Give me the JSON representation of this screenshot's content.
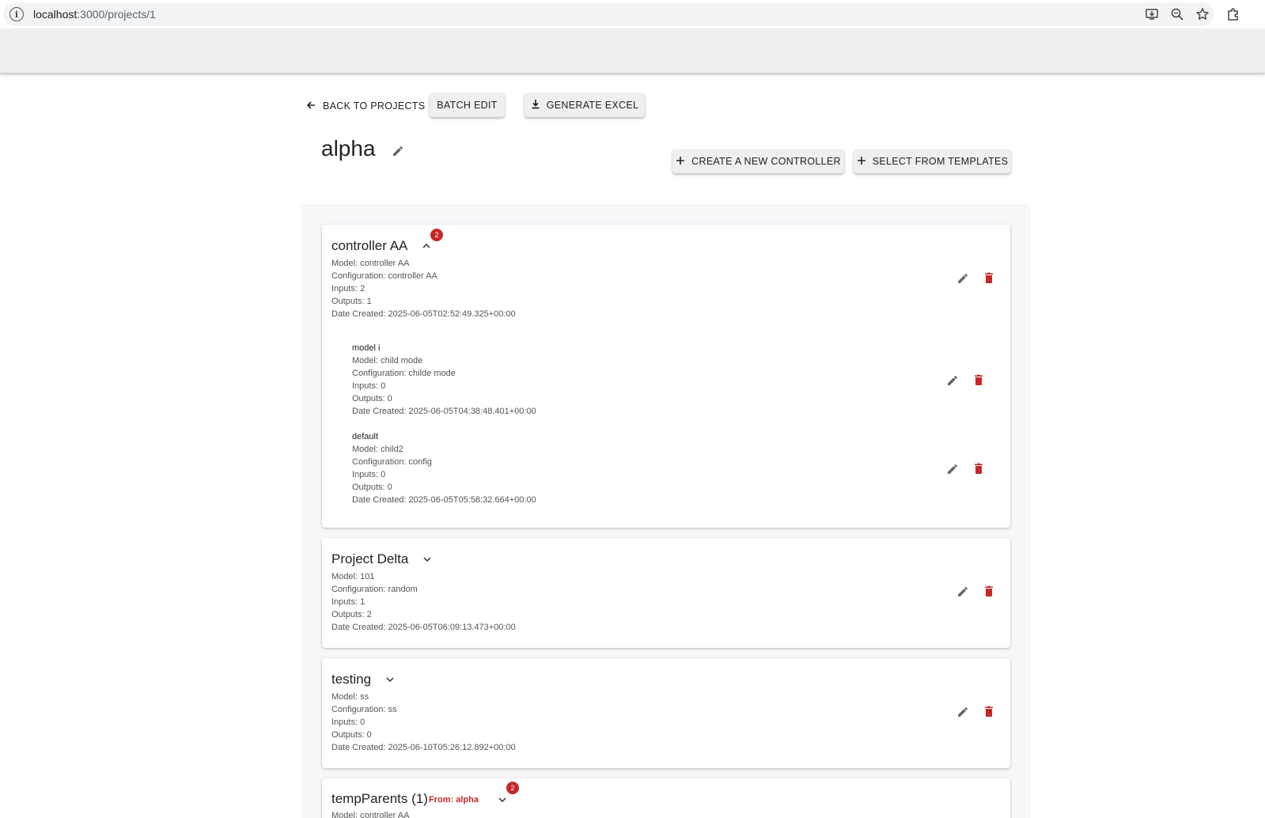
{
  "browser": {
    "url_host": "localhost",
    "url_path": ":3000/projects/1"
  },
  "actions": {
    "back_label": "BACK TO PROJECTS",
    "batch_edit_label": "BATCH EDIT",
    "generate_excel_label": "GENERATE EXCEL",
    "create_controller_label": "CREATE A NEW CONTROLLER",
    "select_templates_label": "SELECT FROM TEMPLATES"
  },
  "project": {
    "title": "alpha"
  },
  "controllers": [
    {
      "name": "controller AA",
      "badge": "2",
      "expanded": true,
      "model": "Model: controller AA",
      "configuration": "Configuration: controller AA",
      "inputs": "Inputs: 2",
      "outputs": "Outputs: 1",
      "date_created": "Date Created: 2025-06-05T02:52:49.325+00:00",
      "children": [
        {
          "name": "model i",
          "model": "Model: child mode",
          "configuration": "Configuration: childe mode",
          "inputs": "Inputs: 0",
          "outputs": "Outputs: 0",
          "date_created": "Date Created: 2025-06-05T04:38:48.401+00:00"
        },
        {
          "name": "default",
          "model": "Model: child2",
          "configuration": "Configuration: config",
          "inputs": "Inputs: 0",
          "outputs": "Outputs: 0",
          "date_created": "Date Created: 2025-06-05T05:58:32.664+00:00"
        }
      ]
    },
    {
      "name": "Project Delta",
      "expanded": false,
      "model": "Model: 101",
      "configuration": "Configuration: random",
      "inputs": "Inputs: 1",
      "outputs": "Outputs: 2",
      "date_created": "Date Created: 2025-06-05T06:09:13.473+00:00"
    },
    {
      "name": "testing",
      "expanded": false,
      "model": "Model: ss",
      "configuration": "Configuration: ss",
      "inputs": "Inputs: 0",
      "outputs": "Outputs: 0",
      "date_created": "Date Created: 2025-06-10T05:26:12.892+00:00"
    },
    {
      "name": "tempParents (1)",
      "from_tag": "From: alpha",
      "badge": "2",
      "expanded": false,
      "model": "Model: controller AA"
    }
  ],
  "icons": {
    "site_info": "info-icon",
    "install": "install-app-icon",
    "zoom": "zoom-icon",
    "bookmark": "star-icon",
    "extensions": "puzzle-icon",
    "back": "arrow-left-icon",
    "download": "download-icon",
    "add": "plus-icon",
    "edit": "pencil-icon",
    "delete": "trash-icon",
    "expand": "chevron-down-icon",
    "collapse": "chevron-up-icon"
  },
  "colors": {
    "danger": "#c62828",
    "toolbar_bg": "#eef0f0",
    "panel_bg": "#f6f7f9"
  }
}
